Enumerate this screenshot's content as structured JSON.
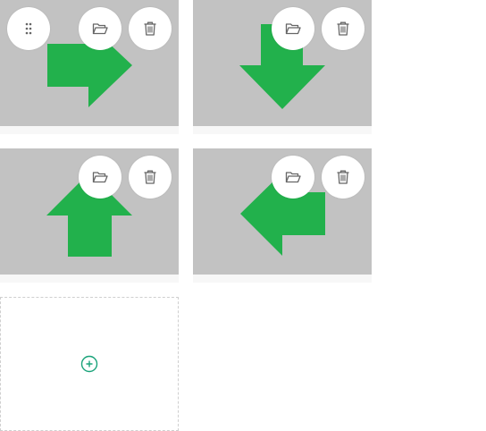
{
  "colors": {
    "thumbnail_bg": "#c2c2c2",
    "arrow_green": "#22b14c",
    "card_footer": "#f7f7f7",
    "icon_gray": "#666666",
    "add_accent": "#1aa37a",
    "dashed_border": "#cfcfcf"
  },
  "cards": [
    {
      "arrow": "right",
      "icons": [
        "drag-handle-icon",
        "folder-open-icon",
        "trash-icon"
      ]
    },
    {
      "arrow": "down",
      "icons": [
        "folder-open-icon",
        "trash-icon"
      ]
    },
    {
      "arrow": "up",
      "icons": [
        "folder-open-icon",
        "trash-icon"
      ]
    },
    {
      "arrow": "left",
      "icons": [
        "folder-open-icon",
        "trash-icon"
      ]
    }
  ],
  "add_tile": {
    "icon": "add-circle-icon"
  }
}
